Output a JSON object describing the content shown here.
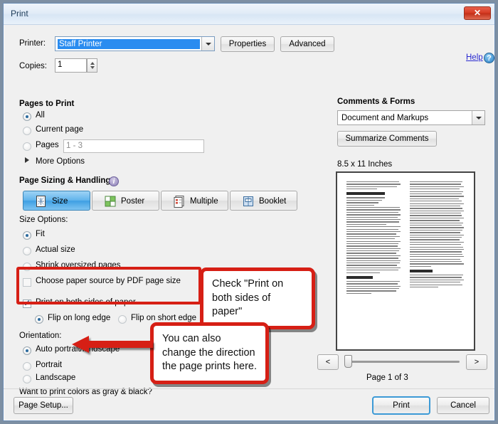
{
  "window": {
    "title": "Print",
    "close_label": "✕"
  },
  "printer": {
    "label": "Printer:",
    "value": "Staff Printer",
    "properties_label": "Properties",
    "advanced_label": "Advanced",
    "help_label": "Help",
    "help_icon": "question-mark-icon"
  },
  "copies": {
    "label": "Copies:",
    "value": "1"
  },
  "pages_to_print": {
    "heading": "Pages to Print",
    "options": [
      {
        "label": "All",
        "selected": true
      },
      {
        "label": "Current page",
        "selected": false
      },
      {
        "label": "Pages",
        "selected": false
      }
    ],
    "pages_value": "1 - 3",
    "more_options_label": "More Options"
  },
  "page_sizing": {
    "heading": "Page Sizing & Handling",
    "info_icon": "info-icon",
    "modes": [
      {
        "label": "Size",
        "icon": "page-size-icon",
        "active": true
      },
      {
        "label": "Poster",
        "icon": "poster-grid-icon",
        "active": false
      },
      {
        "label": "Multiple",
        "icon": "multiple-pages-icon",
        "active": false
      },
      {
        "label": "Booklet",
        "icon": "booklet-icon",
        "active": false
      }
    ],
    "size_options_label": "Size Options:",
    "size_options": [
      {
        "label": "Fit",
        "selected": true
      },
      {
        "label": "Actual size",
        "selected": false
      },
      {
        "label": "Shrink oversized pages",
        "selected": false
      }
    ],
    "paper_source_label": "Choose paper source by PDF page size",
    "paper_source_checked": false,
    "duplex_label": "Print on both sides of paper",
    "duplex_checked": true,
    "flip_options": [
      {
        "label": "Flip on long edge",
        "selected": true
      },
      {
        "label": "Flip on short edge",
        "selected": false
      }
    ]
  },
  "orientation": {
    "heading": "Orientation:",
    "options": [
      {
        "label": "Auto portrait/landscape",
        "selected": true
      },
      {
        "label": "Portrait",
        "selected": false
      },
      {
        "label": "Landscape",
        "selected": false
      }
    ],
    "gray_black_link": "Want to print colors as gray & black?"
  },
  "comments": {
    "heading": "Comments & Forms",
    "dropdown_value": "Document and Markups",
    "summarize_label": "Summarize Comments"
  },
  "preview": {
    "paper_size": "8.5 x 11 Inches",
    "prev_label": "<",
    "next_label": ">",
    "page_status": "Page 1 of 3"
  },
  "footer": {
    "page_setup_label": "Page Setup...",
    "print_label": "Print",
    "cancel_label": "Cancel"
  },
  "annotations": {
    "callout_duplex": "Check \"Print on both sides of paper\"",
    "callout_orientation": "You can also change the direction the page prints here.",
    "highlight_color": "#d61f15"
  }
}
